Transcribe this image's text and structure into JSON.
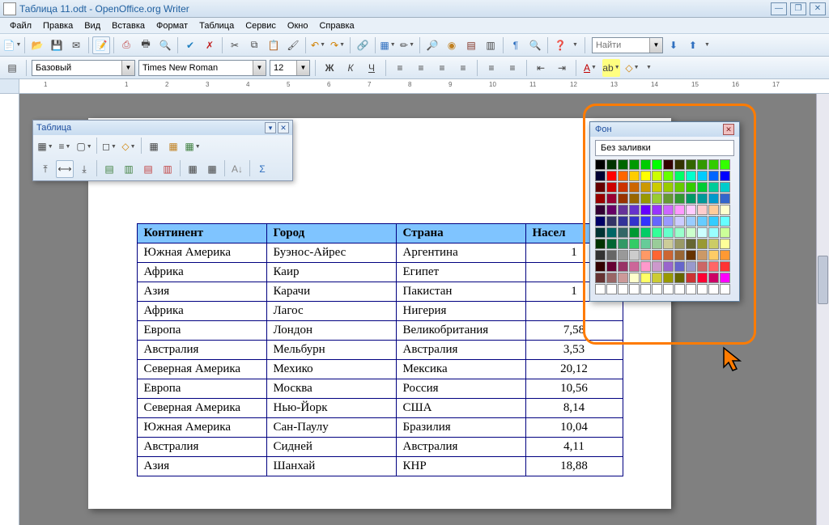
{
  "window": {
    "title": "Таблица 11.odt - OpenOffice.org Writer"
  },
  "menu": [
    "Файл",
    "Правка",
    "Вид",
    "Вставка",
    "Формат",
    "Таблица",
    "Сервис",
    "Окно",
    "Справка"
  ],
  "format": {
    "style": "Базовый",
    "font": "Times New Roman",
    "size": "12"
  },
  "find": {
    "placeholder": "Найти"
  },
  "float_toolbar": {
    "title": "Таблица"
  },
  "color_popup": {
    "title": "Фон",
    "nofill": "Без заливки"
  },
  "table": {
    "headers": [
      "Континент",
      "Город",
      "Страна",
      "Насел"
    ],
    "rows": [
      [
        "Южная Америка",
        "Буэнос-Айрес",
        "Аргентина",
        "1"
      ],
      [
        "Африка",
        "Каир",
        "Египет",
        ""
      ],
      [
        "Азия",
        "Карачи",
        "Пакистан",
        "1"
      ],
      [
        "Африка",
        "Лагос",
        "Нигерия",
        ""
      ],
      [
        "Европа",
        "Лондон",
        "Великобритания",
        "7,58"
      ],
      [
        "Австралия",
        "Мельбурн",
        "Австралия",
        "3,53"
      ],
      [
        "Северная Америка",
        "Мехико",
        "Мексика",
        "20,12"
      ],
      [
        "Европа",
        "Москва",
        "Россия",
        "10,56"
      ],
      [
        "Северная Америка",
        "Нью-Йорк",
        "США",
        "8,14"
      ],
      [
        "Южная Америка",
        "Сан-Паулу",
        "Бразилия",
        "10,04"
      ],
      [
        "Австралия",
        "Сидней",
        "Австралия",
        "4,11"
      ],
      [
        "Азия",
        "Шанхай",
        "КНР",
        "18,88"
      ]
    ]
  },
  "ruler_marks": [
    "1",
    "",
    "1",
    "2",
    "3",
    "4",
    "5",
    "6",
    "7",
    "8",
    "9",
    "10",
    "11",
    "12",
    "13",
    "14",
    "15",
    "16",
    "17"
  ],
  "colors": [
    "#000000",
    "#003300",
    "#006600",
    "#009900",
    "#00cc00",
    "#00ff00",
    "#330000",
    "#333300",
    "#336600",
    "#339900",
    "#33cc00",
    "#33ff00",
    "#000033",
    "#ff0000",
    "#ff6600",
    "#ffcc00",
    "#ffff00",
    "#ccff00",
    "#66ff00",
    "#00ff66",
    "#00ffcc",
    "#00ccff",
    "#0066ff",
    "#0000ff",
    "#660000",
    "#cc0000",
    "#cc3300",
    "#cc6600",
    "#cc9900",
    "#cccc00",
    "#99cc00",
    "#66cc00",
    "#33cc00",
    "#00cc33",
    "#00cc99",
    "#00cccc",
    "#990000",
    "#990033",
    "#993300",
    "#996600",
    "#999900",
    "#99cc33",
    "#669933",
    "#339933",
    "#009966",
    "#009999",
    "#0099cc",
    "#3366cc",
    "#330033",
    "#660066",
    "#663399",
    "#6633cc",
    "#6600ff",
    "#9933ff",
    "#cc66ff",
    "#ff99ff",
    "#ffccff",
    "#ffcccc",
    "#ffcc99",
    "#ffffcc",
    "#000066",
    "#333366",
    "#333399",
    "#3333cc",
    "#3333ff",
    "#6666ff",
    "#9999ff",
    "#ccccff",
    "#99ccff",
    "#66ccff",
    "#33ccff",
    "#66ffff",
    "#003333",
    "#006666",
    "#336666",
    "#009933",
    "#00cc66",
    "#33ff99",
    "#66ffcc",
    "#99ffcc",
    "#ccffcc",
    "#ccffff",
    "#99ffff",
    "#ccff99",
    "#003300",
    "#006633",
    "#339966",
    "#33cc66",
    "#66cc99",
    "#99cc99",
    "#cccc99",
    "#999966",
    "#666633",
    "#999933",
    "#cccc66",
    "#ffff99",
    "#333333",
    "#666666",
    "#999999",
    "#cccccc",
    "#ff9966",
    "#ff6633",
    "#cc6633",
    "#996633",
    "#663300",
    "#cc9966",
    "#ffcc66",
    "#ff9933",
    "#330000",
    "#660033",
    "#993366",
    "#cc6699",
    "#ff99cc",
    "#cc99cc",
    "#9966cc",
    "#6666cc",
    "#9999cc",
    "#cc6666",
    "#ff6666",
    "#ff3333",
    "#663333",
    "#996666",
    "#cc9999",
    "#ffffcc",
    "#ffff66",
    "#cccc33",
    "#999900",
    "#666600",
    "#cc3333",
    "#ff0033",
    "#cc0066",
    "#ff00ff",
    "#ffffff",
    "#ffffff",
    "#ffffff",
    "#ffffff",
    "#ffffff",
    "#ffffff",
    "#ffffff",
    "#ffffff",
    "#ffffff",
    "#ffffff",
    "#ffffff",
    "#ffffff"
  ]
}
